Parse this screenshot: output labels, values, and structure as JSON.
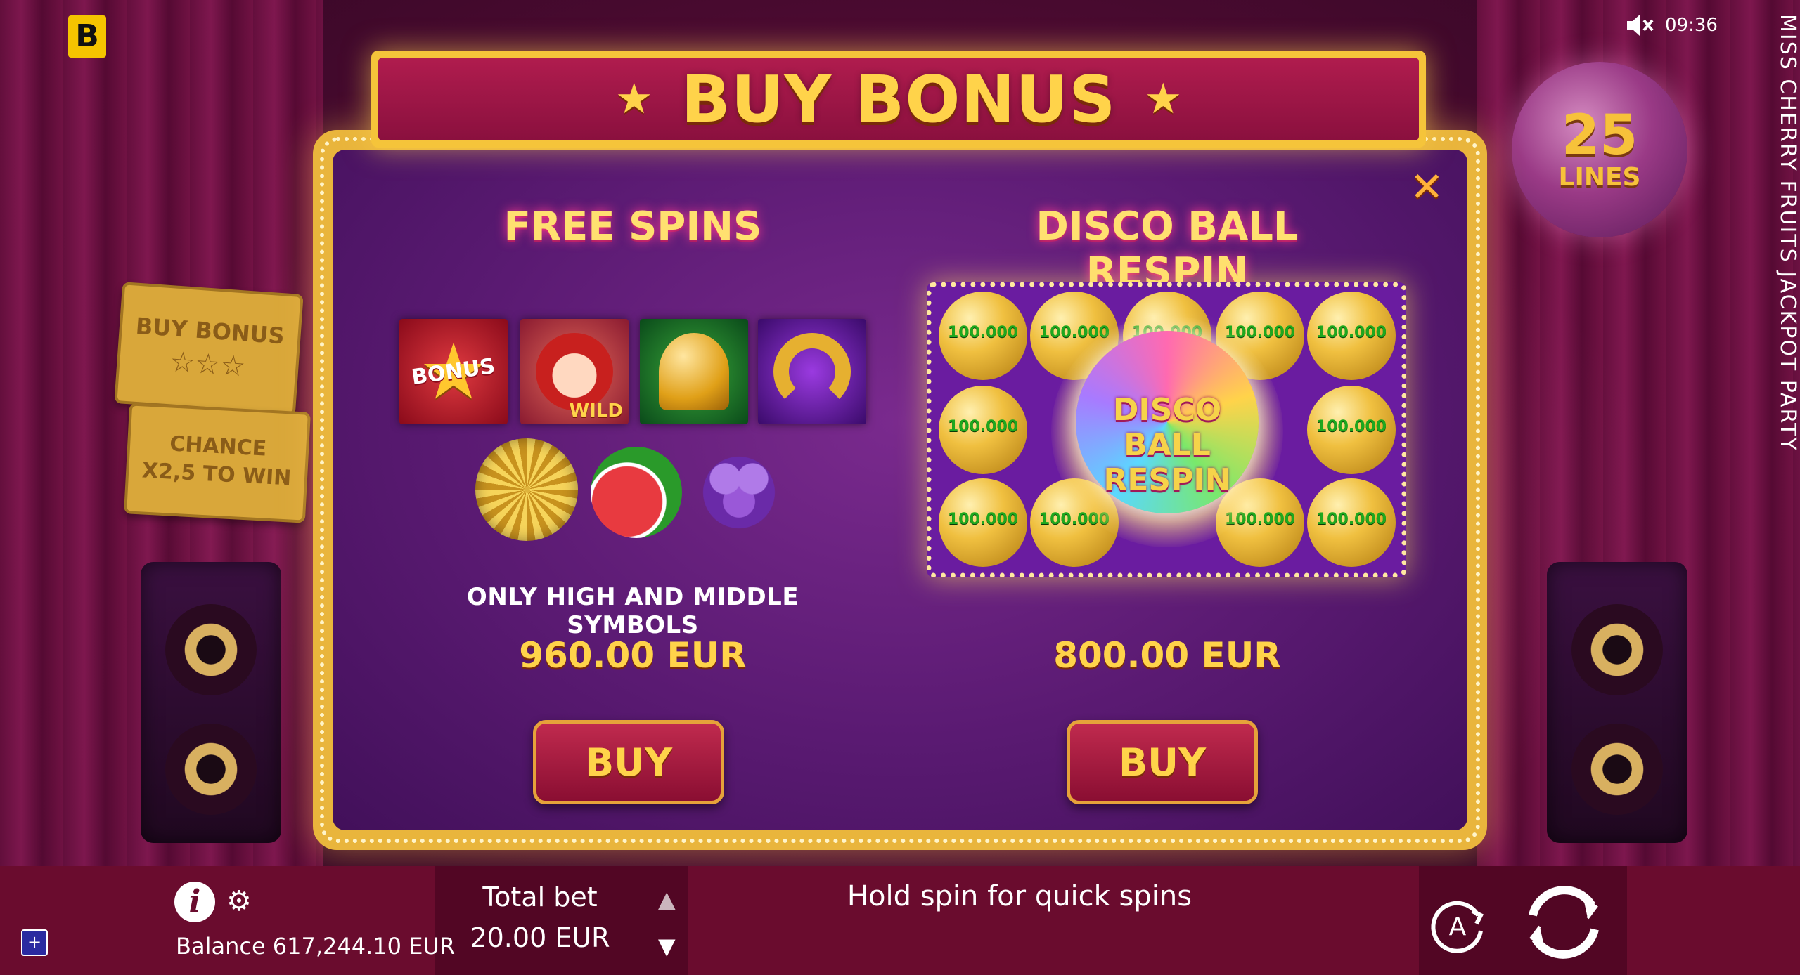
{
  "game": {
    "title": "MISS CHERRY FRUITS JACKPOT PARTY",
    "logo_letter": "B",
    "lines_value": "25",
    "lines_label": "LINES"
  },
  "status": {
    "time": "09:36",
    "sound_icon": "speaker-muted-icon"
  },
  "side_tickets": {
    "buy_bonus": "BUY BONUS",
    "stars": "☆☆☆",
    "chance_line1": "CHANCE",
    "chance_line2": "X2,5 TO WIN"
  },
  "dialog": {
    "title": "BUY BONUS",
    "close_icon": "close-icon",
    "free_spins": {
      "title": "FREE SPINS",
      "symbols": [
        "BONUS",
        "WILD",
        "bell",
        "horseshoe",
        "disco-ball",
        "watermelon",
        "grapes"
      ],
      "bonus_label": "BONUS",
      "wild_label": "WILD",
      "description": "ONLY HIGH AND MIDDLE SYMBOLS",
      "price": "960.00 EUR",
      "buy_label": "BUY"
    },
    "disco_ball_respin": {
      "title": "DISCO BALL RESPIN",
      "coin_value": "100.000",
      "center_line1": "DISCO BALL",
      "center_line2": "RESPIN",
      "price": "800.00 EUR",
      "buy_label": "BUY"
    }
  },
  "bottom_bar": {
    "badge": "+",
    "balance": "Balance 617,244.10 EUR",
    "total_bet_label": "Total bet",
    "total_bet_value": "20.00 EUR",
    "hint": "Hold spin for quick spins",
    "auto_label": "A"
  },
  "colors": {
    "gold": "#ffd34a",
    "panel_purple": "#5a1a72",
    "bar_red": "#6a0c2e",
    "button_red": "#a01a40"
  }
}
